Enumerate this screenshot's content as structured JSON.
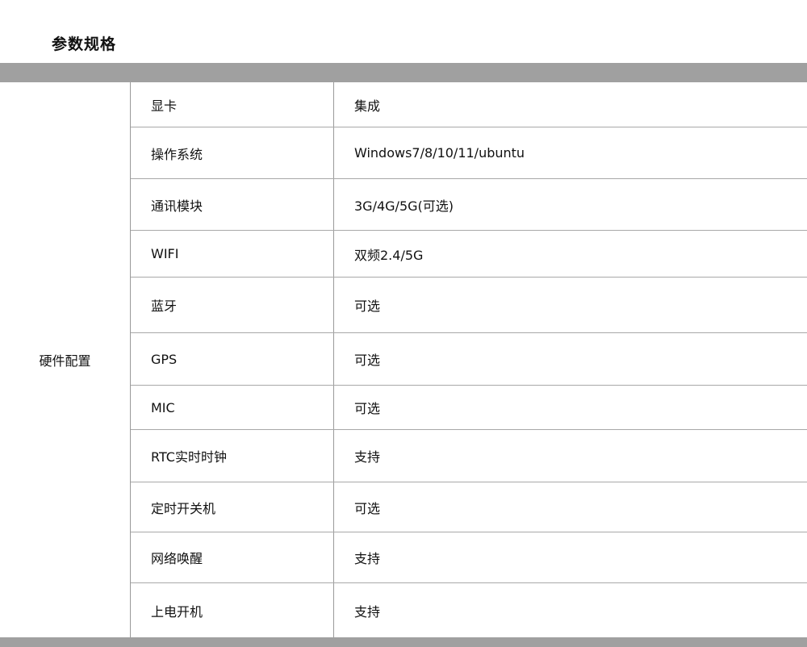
{
  "title": "参数规格",
  "group_label": "硬件配置",
  "rows": [
    {
      "key": "显卡",
      "value": "集成"
    },
    {
      "key": "操作系统",
      "value": "Windows7/8/10/11/ubuntu"
    },
    {
      "key": "通讯模块",
      "value": "3G/4G/5G(可选)"
    },
    {
      "key": "WIFI",
      "value": "双频2.4/5G"
    },
    {
      "key": "蓝牙",
      "value": "可选"
    },
    {
      "key": "GPS",
      "value": "可选"
    },
    {
      "key": "MIC",
      "value": "可选"
    },
    {
      "key": "RTC实时时钟",
      "value": "支持"
    },
    {
      "key": "定时开关机",
      "value": "可选"
    },
    {
      "key": "网络唤醒",
      "value": "支持"
    },
    {
      "key": "上电开机",
      "value": "支持"
    }
  ]
}
